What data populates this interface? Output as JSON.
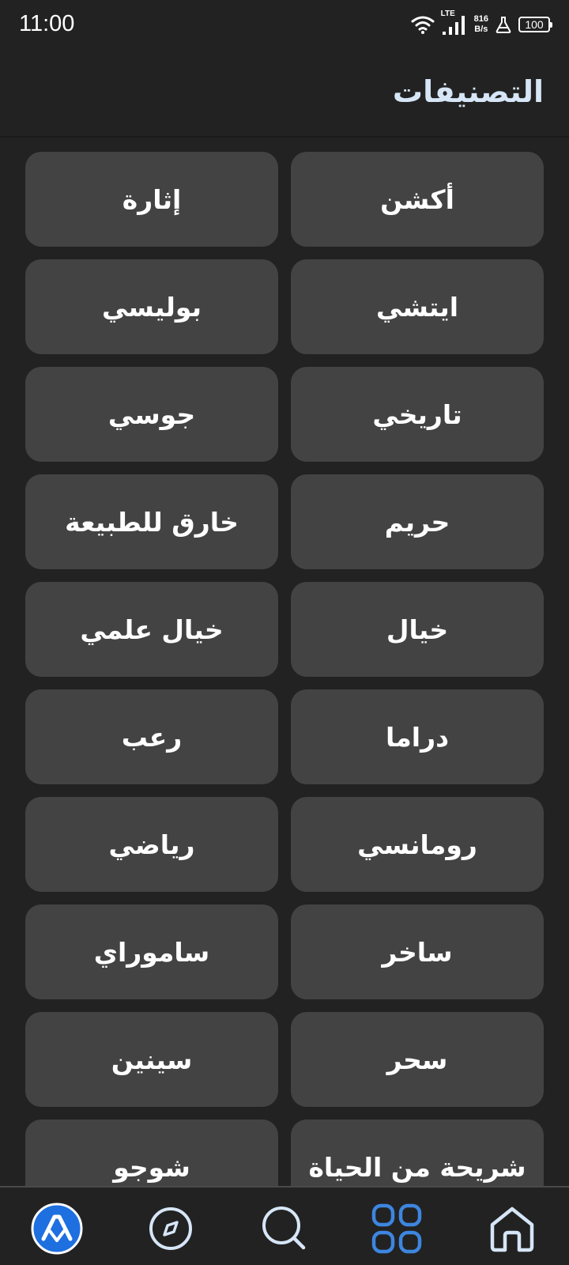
{
  "status_bar": {
    "time": "11:00",
    "network_type": "LTE",
    "speed_value": "816",
    "speed_unit": "B/s",
    "battery": "100"
  },
  "header": {
    "title": "التصنيفات"
  },
  "categories": [
    "أكشن",
    "إثارة",
    "ايتشي",
    "بوليسي",
    "تاريخي",
    "جوسي",
    "حريم",
    "خارق للطبيعة",
    "خيال",
    "خيال علمي",
    "دراما",
    "رعب",
    "رومانسي",
    "رياضي",
    "ساخر",
    "ساموراي",
    "سحر",
    "سينين",
    "شريحة من الحياة",
    "شوجو"
  ],
  "bottom_nav": {
    "items": [
      "app-logo-icon",
      "compass-icon",
      "search-icon",
      "grid-icon",
      "home-icon"
    ],
    "active": "grid-icon",
    "active_color": "#3d86e0",
    "logo_color": "#1e6fe0"
  },
  "colors": {
    "background": "#222222",
    "tile": "#434343",
    "title": "#d6e6f7"
  }
}
